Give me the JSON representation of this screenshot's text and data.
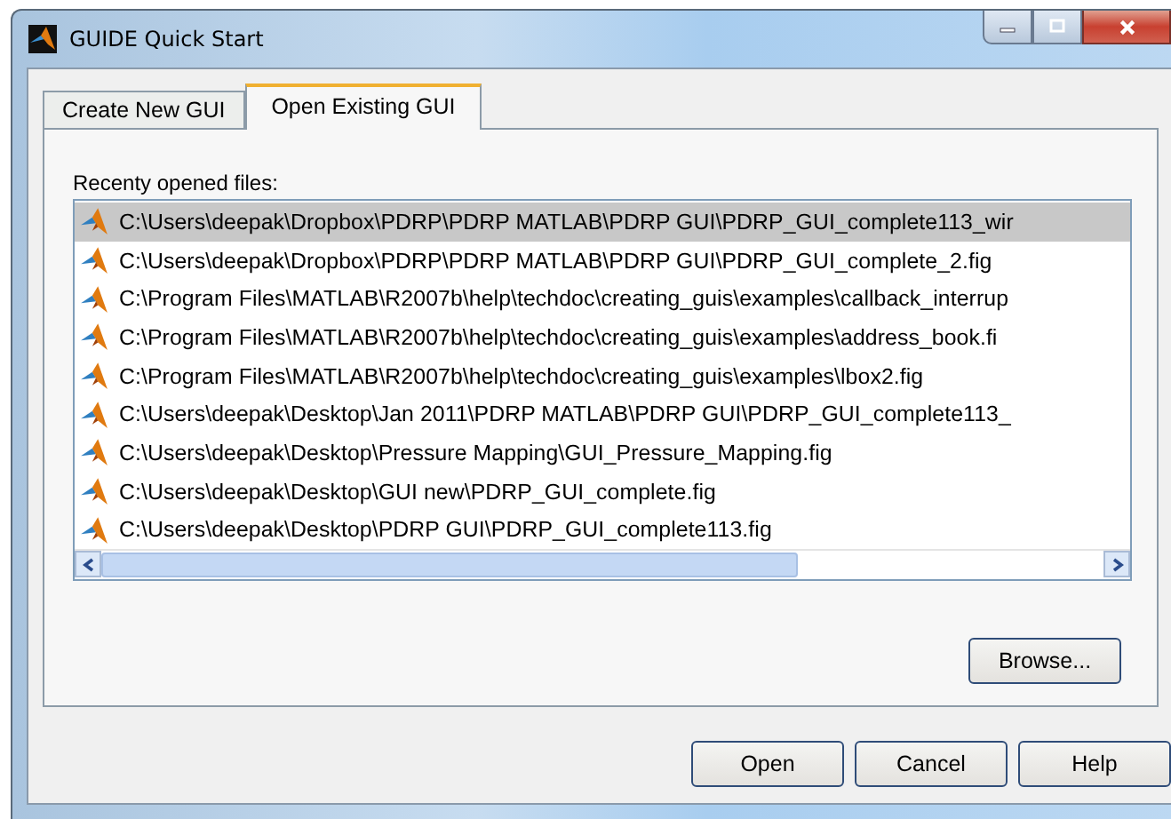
{
  "window": {
    "title": "GUIDE Quick Start"
  },
  "tabs": [
    {
      "label": "Create New GUI",
      "selected": false
    },
    {
      "label": "Open Existing GUI",
      "selected": true
    }
  ],
  "recent_files": {
    "label": "Recenty opened files:",
    "items": [
      {
        "path": "C:\\Users\\deepak\\Dropbox\\PDRP\\PDRP MATLAB\\PDRP GUI\\PDRP_GUI_complete113_wir",
        "selected": true
      },
      {
        "path": "C:\\Users\\deepak\\Dropbox\\PDRP\\PDRP MATLAB\\PDRP GUI\\PDRP_GUI_complete_2.fig",
        "selected": false
      },
      {
        "path": "C:\\Program Files\\MATLAB\\R2007b\\help\\techdoc\\creating_guis\\examples\\callback_interrup",
        "selected": false
      },
      {
        "path": "C:\\Program Files\\MATLAB\\R2007b\\help\\techdoc\\creating_guis\\examples\\address_book.fi",
        "selected": false
      },
      {
        "path": "C:\\Program Files\\MATLAB\\R2007b\\help\\techdoc\\creating_guis\\examples\\lbox2.fig",
        "selected": false
      },
      {
        "path": "C:\\Users\\deepak\\Desktop\\Jan 2011\\PDRP MATLAB\\PDRP GUI\\PDRP_GUI_complete113_",
        "selected": false
      },
      {
        "path": "C:\\Users\\deepak\\Desktop\\Pressure Mapping\\GUI_Pressure_Mapping.fig",
        "selected": false
      },
      {
        "path": "C:\\Users\\deepak\\Desktop\\GUI new\\PDRP_GUI_complete.fig",
        "selected": false
      },
      {
        "path": "C:\\Users\\deepak\\Desktop\\PDRP GUI\\PDRP_GUI_complete113.fig",
        "selected": false
      }
    ]
  },
  "browse_button": "Browse...",
  "buttons": [
    "Open",
    "Cancel",
    "Help"
  ]
}
